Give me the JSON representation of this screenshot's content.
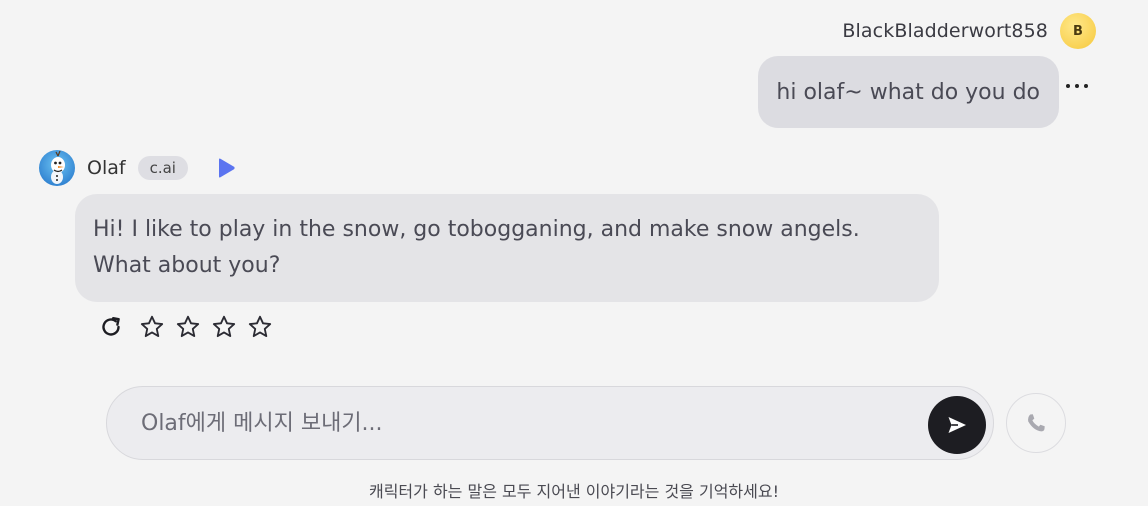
{
  "user_message": {
    "username": "BlackBladderwort858",
    "avatar_initial": "B",
    "text": "hi olaf~ what do you do",
    "more_icon": "ellipsis-icon"
  },
  "bot_message": {
    "name": "Olaf",
    "badge": "c.ai",
    "play_icon": "play-icon",
    "text_line1": "Hi! I like to play in the snow, go tobogganing, and make snow angels.",
    "text_line2": "What about you?",
    "regenerate_icon": "refresh-icon",
    "rating": {
      "max": 5,
      "value": 0
    }
  },
  "composer": {
    "placeholder": "Olaf에게 메시지 보내기...",
    "value": "",
    "send_icon": "send-icon",
    "call_icon": "phone-icon"
  },
  "disclaimer": "캐릭터가 하는 말은 모두 지어낸 이야기라는 것을 기억하세요!",
  "colors": {
    "background": "#f4f4f4",
    "user_bubble": "#dcdce1",
    "bot_bubble": "#e4e4e7",
    "play_accent": "#5b74f0",
    "send_button": "#1d1d22",
    "avatar_yellow": "#f6c83c"
  }
}
